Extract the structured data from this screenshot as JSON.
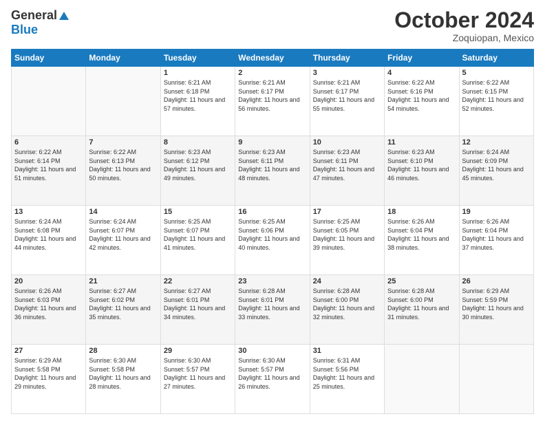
{
  "header": {
    "logo_general": "General",
    "logo_blue": "Blue",
    "month_title": "October 2024",
    "location": "Zoquiopan, Mexico"
  },
  "days_of_week": [
    "Sunday",
    "Monday",
    "Tuesday",
    "Wednesday",
    "Thursday",
    "Friday",
    "Saturday"
  ],
  "weeks": [
    [
      {
        "day": "",
        "sunrise": "",
        "sunset": "",
        "daylight": ""
      },
      {
        "day": "",
        "sunrise": "",
        "sunset": "",
        "daylight": ""
      },
      {
        "day": "1",
        "sunrise": "Sunrise: 6:21 AM",
        "sunset": "Sunset: 6:18 PM",
        "daylight": "Daylight: 11 hours and 57 minutes."
      },
      {
        "day": "2",
        "sunrise": "Sunrise: 6:21 AM",
        "sunset": "Sunset: 6:17 PM",
        "daylight": "Daylight: 11 hours and 56 minutes."
      },
      {
        "day": "3",
        "sunrise": "Sunrise: 6:21 AM",
        "sunset": "Sunset: 6:17 PM",
        "daylight": "Daylight: 11 hours and 55 minutes."
      },
      {
        "day": "4",
        "sunrise": "Sunrise: 6:22 AM",
        "sunset": "Sunset: 6:16 PM",
        "daylight": "Daylight: 11 hours and 54 minutes."
      },
      {
        "day": "5",
        "sunrise": "Sunrise: 6:22 AM",
        "sunset": "Sunset: 6:15 PM",
        "daylight": "Daylight: 11 hours and 52 minutes."
      }
    ],
    [
      {
        "day": "6",
        "sunrise": "Sunrise: 6:22 AM",
        "sunset": "Sunset: 6:14 PM",
        "daylight": "Daylight: 11 hours and 51 minutes."
      },
      {
        "day": "7",
        "sunrise": "Sunrise: 6:22 AM",
        "sunset": "Sunset: 6:13 PM",
        "daylight": "Daylight: 11 hours and 50 minutes."
      },
      {
        "day": "8",
        "sunrise": "Sunrise: 6:23 AM",
        "sunset": "Sunset: 6:12 PM",
        "daylight": "Daylight: 11 hours and 49 minutes."
      },
      {
        "day": "9",
        "sunrise": "Sunrise: 6:23 AM",
        "sunset": "Sunset: 6:11 PM",
        "daylight": "Daylight: 11 hours and 48 minutes."
      },
      {
        "day": "10",
        "sunrise": "Sunrise: 6:23 AM",
        "sunset": "Sunset: 6:11 PM",
        "daylight": "Daylight: 11 hours and 47 minutes."
      },
      {
        "day": "11",
        "sunrise": "Sunrise: 6:23 AM",
        "sunset": "Sunset: 6:10 PM",
        "daylight": "Daylight: 11 hours and 46 minutes."
      },
      {
        "day": "12",
        "sunrise": "Sunrise: 6:24 AM",
        "sunset": "Sunset: 6:09 PM",
        "daylight": "Daylight: 11 hours and 45 minutes."
      }
    ],
    [
      {
        "day": "13",
        "sunrise": "Sunrise: 6:24 AM",
        "sunset": "Sunset: 6:08 PM",
        "daylight": "Daylight: 11 hours and 44 minutes."
      },
      {
        "day": "14",
        "sunrise": "Sunrise: 6:24 AM",
        "sunset": "Sunset: 6:07 PM",
        "daylight": "Daylight: 11 hours and 42 minutes."
      },
      {
        "day": "15",
        "sunrise": "Sunrise: 6:25 AM",
        "sunset": "Sunset: 6:07 PM",
        "daylight": "Daylight: 11 hours and 41 minutes."
      },
      {
        "day": "16",
        "sunrise": "Sunrise: 6:25 AM",
        "sunset": "Sunset: 6:06 PM",
        "daylight": "Daylight: 11 hours and 40 minutes."
      },
      {
        "day": "17",
        "sunrise": "Sunrise: 6:25 AM",
        "sunset": "Sunset: 6:05 PM",
        "daylight": "Daylight: 11 hours and 39 minutes."
      },
      {
        "day": "18",
        "sunrise": "Sunrise: 6:26 AM",
        "sunset": "Sunset: 6:04 PM",
        "daylight": "Daylight: 11 hours and 38 minutes."
      },
      {
        "day": "19",
        "sunrise": "Sunrise: 6:26 AM",
        "sunset": "Sunset: 6:04 PM",
        "daylight": "Daylight: 11 hours and 37 minutes."
      }
    ],
    [
      {
        "day": "20",
        "sunrise": "Sunrise: 6:26 AM",
        "sunset": "Sunset: 6:03 PM",
        "daylight": "Daylight: 11 hours and 36 minutes."
      },
      {
        "day": "21",
        "sunrise": "Sunrise: 6:27 AM",
        "sunset": "Sunset: 6:02 PM",
        "daylight": "Daylight: 11 hours and 35 minutes."
      },
      {
        "day": "22",
        "sunrise": "Sunrise: 6:27 AM",
        "sunset": "Sunset: 6:01 PM",
        "daylight": "Daylight: 11 hours and 34 minutes."
      },
      {
        "day": "23",
        "sunrise": "Sunrise: 6:28 AM",
        "sunset": "Sunset: 6:01 PM",
        "daylight": "Daylight: 11 hours and 33 minutes."
      },
      {
        "day": "24",
        "sunrise": "Sunrise: 6:28 AM",
        "sunset": "Sunset: 6:00 PM",
        "daylight": "Daylight: 11 hours and 32 minutes."
      },
      {
        "day": "25",
        "sunrise": "Sunrise: 6:28 AM",
        "sunset": "Sunset: 6:00 PM",
        "daylight": "Daylight: 11 hours and 31 minutes."
      },
      {
        "day": "26",
        "sunrise": "Sunrise: 6:29 AM",
        "sunset": "Sunset: 5:59 PM",
        "daylight": "Daylight: 11 hours and 30 minutes."
      }
    ],
    [
      {
        "day": "27",
        "sunrise": "Sunrise: 6:29 AM",
        "sunset": "Sunset: 5:58 PM",
        "daylight": "Daylight: 11 hours and 29 minutes."
      },
      {
        "day": "28",
        "sunrise": "Sunrise: 6:30 AM",
        "sunset": "Sunset: 5:58 PM",
        "daylight": "Daylight: 11 hours and 28 minutes."
      },
      {
        "day": "29",
        "sunrise": "Sunrise: 6:30 AM",
        "sunset": "Sunset: 5:57 PM",
        "daylight": "Daylight: 11 hours and 27 minutes."
      },
      {
        "day": "30",
        "sunrise": "Sunrise: 6:30 AM",
        "sunset": "Sunset: 5:57 PM",
        "daylight": "Daylight: 11 hours and 26 minutes."
      },
      {
        "day": "31",
        "sunrise": "Sunrise: 6:31 AM",
        "sunset": "Sunset: 5:56 PM",
        "daylight": "Daylight: 11 hours and 25 minutes."
      },
      {
        "day": "",
        "sunrise": "",
        "sunset": "",
        "daylight": ""
      },
      {
        "day": "",
        "sunrise": "",
        "sunset": "",
        "daylight": ""
      }
    ]
  ]
}
